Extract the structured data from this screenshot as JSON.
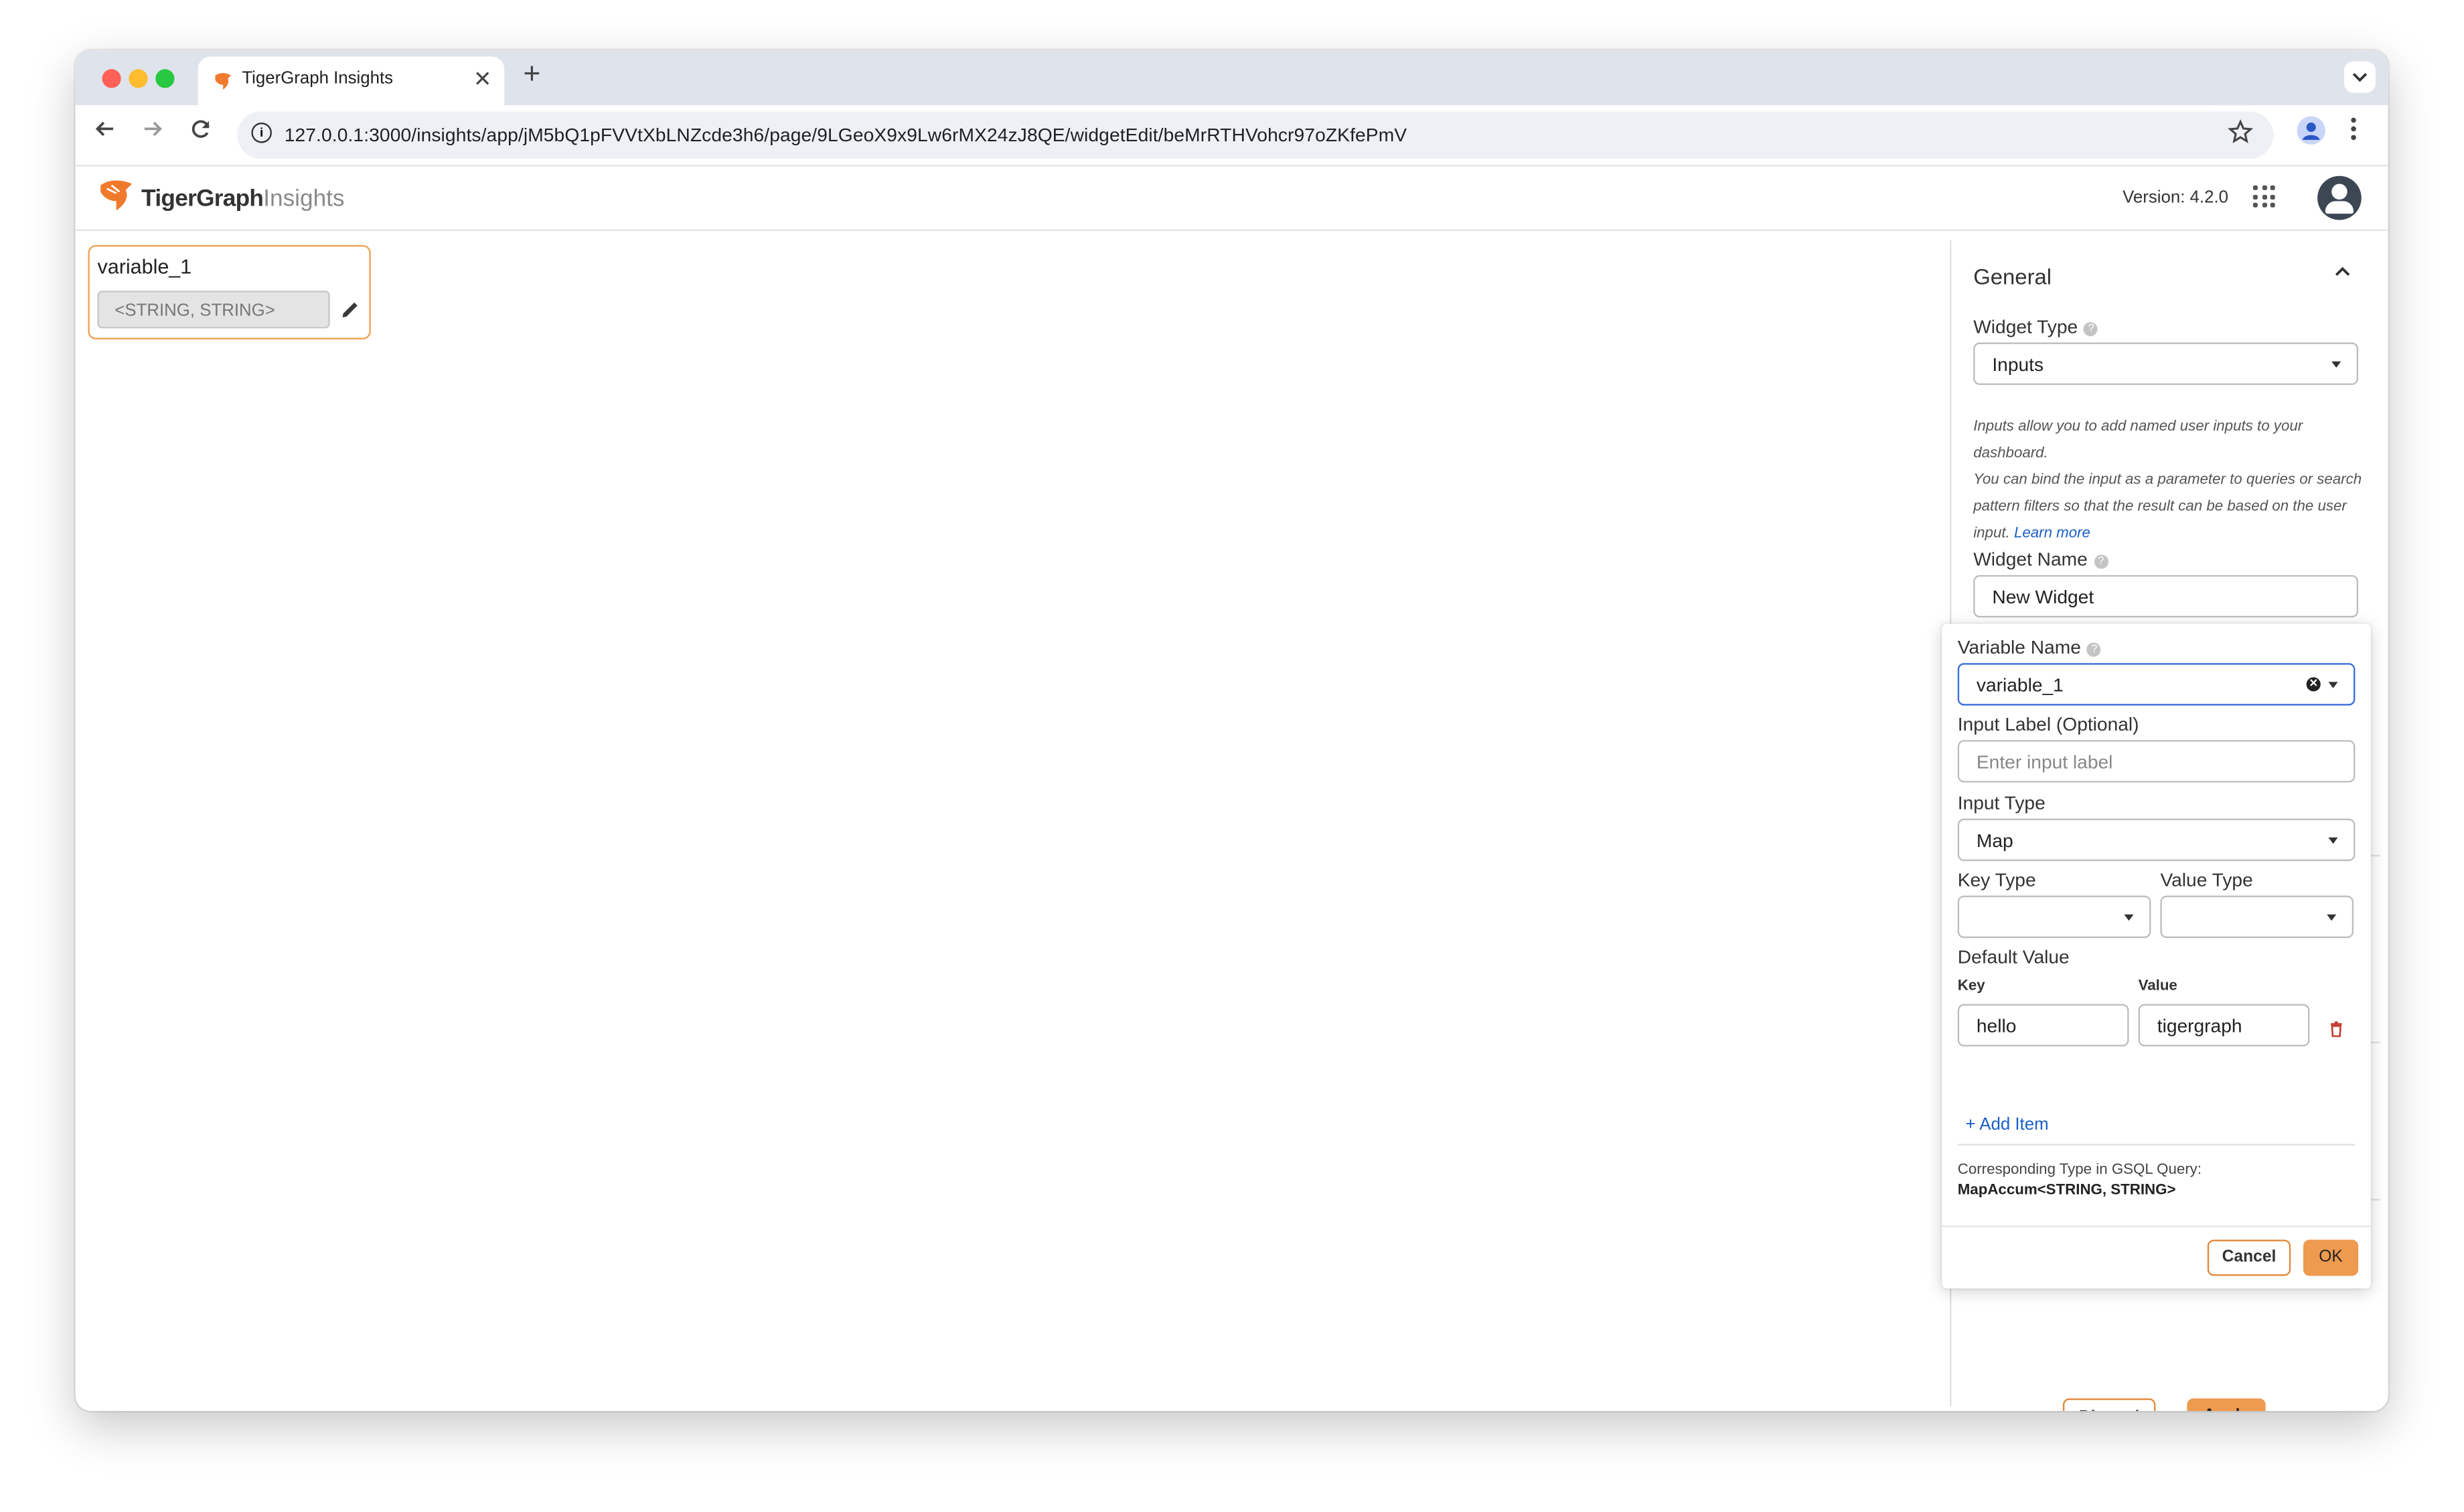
{
  "browser": {
    "tab_title": "TigerGraph Insights",
    "new_tab_symbol": "+",
    "close_symbol": "✕",
    "url": "127.0.0.1:3000/insights/app/jM5bQ1pFVVtXbLNZcde3h6/page/9LGeoX9x9Lw6rMX24zJ8QE/widgetEdit/beMrRTHVohcr97oZKfePmV"
  },
  "app_header": {
    "logo_bold": "TigerGraph",
    "logo_light": "Insights",
    "version": "Version: 4.2.0"
  },
  "canvas_widget": {
    "title": "variable_1",
    "value": "<STRING, STRING>"
  },
  "general_panel": {
    "section_title": "General",
    "widget_type_label": "Widget Type",
    "widget_type_value": "Inputs",
    "description_1": "Inputs allow you to add named user inputs to your dashboard.",
    "description_2": "You can bind the input as a parameter to queries or search pattern filters so that the result can be based on the user input.",
    "learn_more": "Learn more",
    "widget_name_label": "Widget Name",
    "widget_name_value": "New Widget",
    "discard_label": "Discard",
    "apply_label": "Apply"
  },
  "variable_popup": {
    "variable_name_label": "Variable Name",
    "variable_name_value": "variable_1",
    "input_label_label": "Input Label (Optional)",
    "input_label_placeholder": "Enter input label",
    "input_type_label": "Input Type",
    "input_type_value": "Map",
    "key_type_label": "Key Type",
    "key_type_value": "",
    "value_type_label": "Value Type",
    "value_type_value": "",
    "default_value_label": "Default Value",
    "key_column_label": "Key",
    "value_column_label": "Value",
    "items": [
      {
        "key": "hello",
        "value": "tigergraph"
      }
    ],
    "add_item_label": "+ Add Item",
    "corresponding_label": "Corresponding Type in GSQL Query:",
    "corresponding_type": "MapAccum<STRING, STRING>",
    "cancel_label": "Cancel",
    "ok_label": "OK"
  },
  "colors": {
    "accent_orange": "#ee9a4f",
    "link_blue": "#1a5fc8"
  }
}
